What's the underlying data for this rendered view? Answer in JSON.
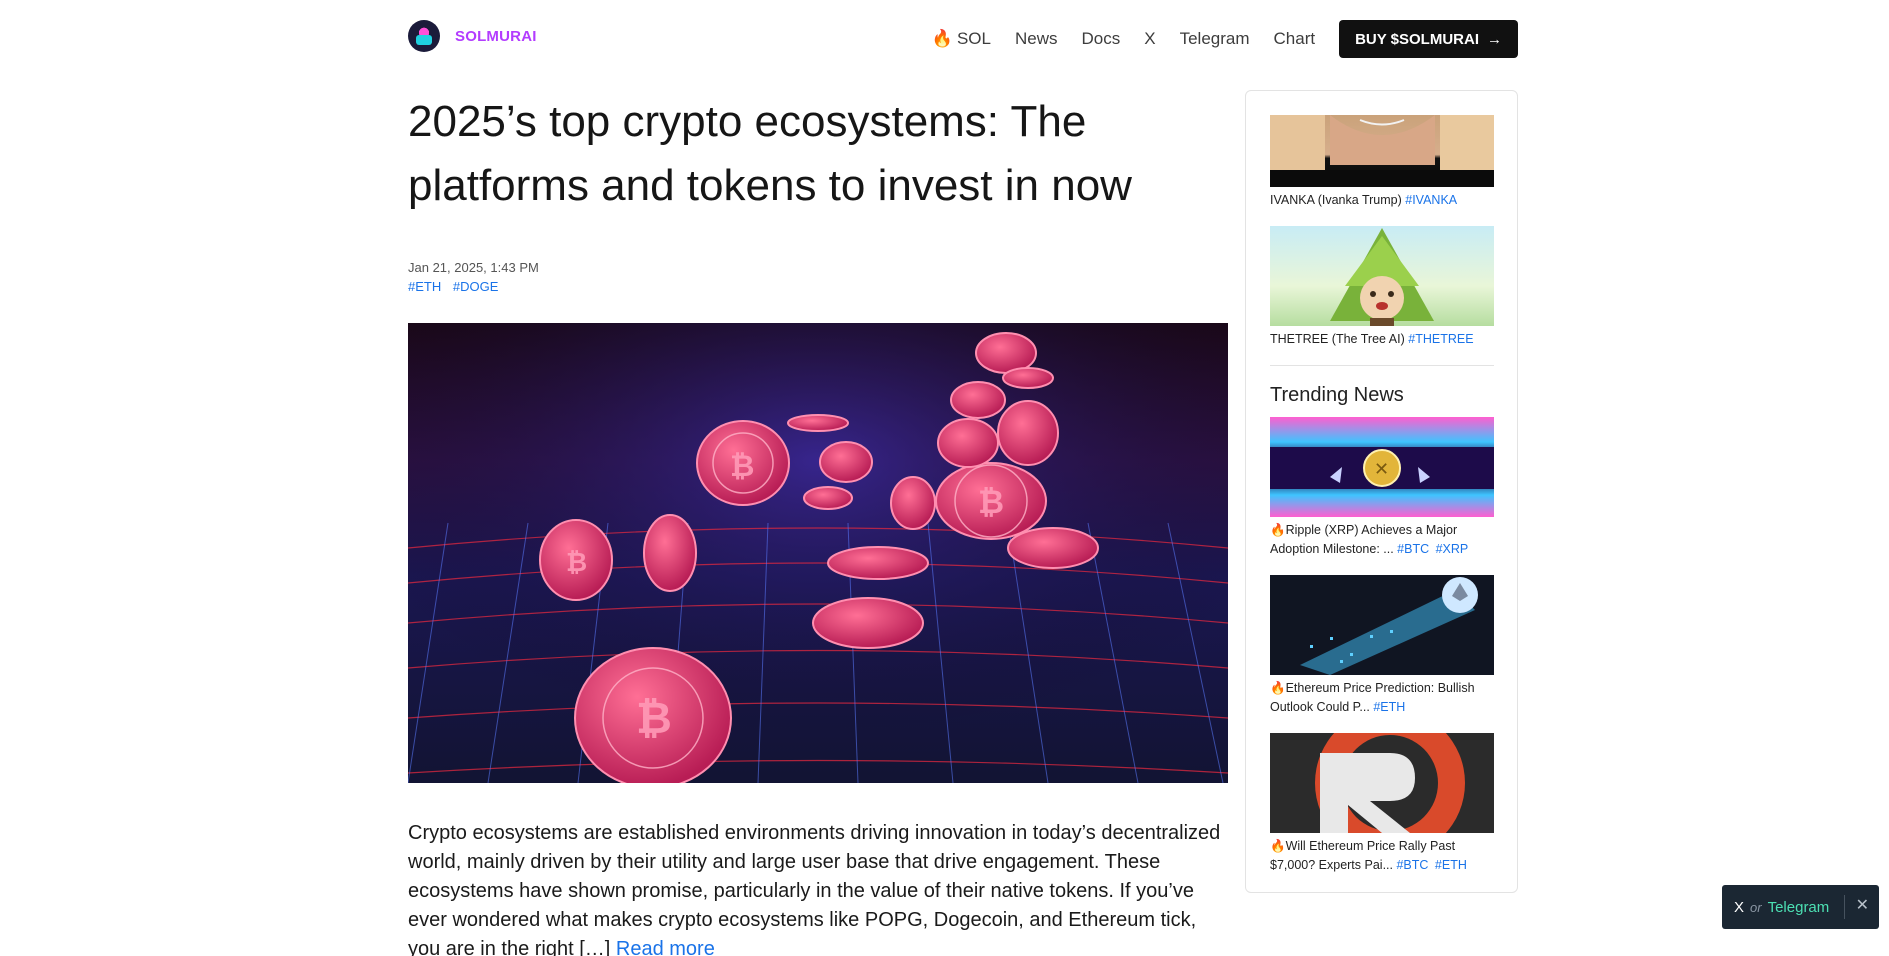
{
  "header": {
    "brand": "SOLMURAI",
    "nav": [
      {
        "label": "SOL",
        "icon": "fire-icon"
      },
      {
        "label": "News"
      },
      {
        "label": "Docs"
      },
      {
        "label": "X"
      },
      {
        "label": "Telegram"
      },
      {
        "label": "Chart"
      }
    ],
    "buy_label": "BUY $SOLMURAI",
    "buy_icon": "arrow-right-icon"
  },
  "article": {
    "title": "2025’s top crypto ecosystems: The platforms and tokens to invest in now",
    "date": "Jan 21, 2025, 1:43 PM",
    "tags": [
      "#ETH",
      "#DOGE"
    ],
    "excerpt": "Crypto ecosystems are established environments driving innovation in today’s decentralized world, mainly driven by their utility and large user base that drive engagement. These ecosystems have shown promise, particularly in the value of their native tokens. If you’ve ever wondered what makes crypto ecosystems like POPG, Dogecoin, and Ethereum tick, you are in the right […]",
    "read_more": "Read more"
  },
  "sidebar": {
    "top_items": [
      {
        "text": "IVANKA (Ivanka Trump)",
        "tag": "#IVANKA"
      },
      {
        "text": "THETREE (The Tree AI)",
        "tag": "#THETREE"
      }
    ],
    "trending_heading": "Trending News",
    "trending": [
      {
        "text": "🔥Ripple (XRP) Achieves a Major Adoption Milestone: ...",
        "tags": [
          "#BTC",
          "#XRP"
        ]
      },
      {
        "text": "🔥Ethereum Price Prediction: Bullish Outlook Could P...",
        "tags": [
          "#ETH"
        ]
      },
      {
        "text": "🔥Will Ethereum Price Rally Past $7,000? Experts Pai...",
        "tags": [
          "#BTC",
          "#ETH"
        ]
      }
    ]
  },
  "social_pill": {
    "x_label": "X",
    "or_label": "or",
    "telegram_label": "Telegram",
    "close_icon": "close-icon"
  },
  "colors": {
    "brand": "#b33cff",
    "link": "#1a73e8",
    "buy_bg": "#111111",
    "pill_bg": "#1b2733",
    "telegram": "#4ce0b3"
  }
}
